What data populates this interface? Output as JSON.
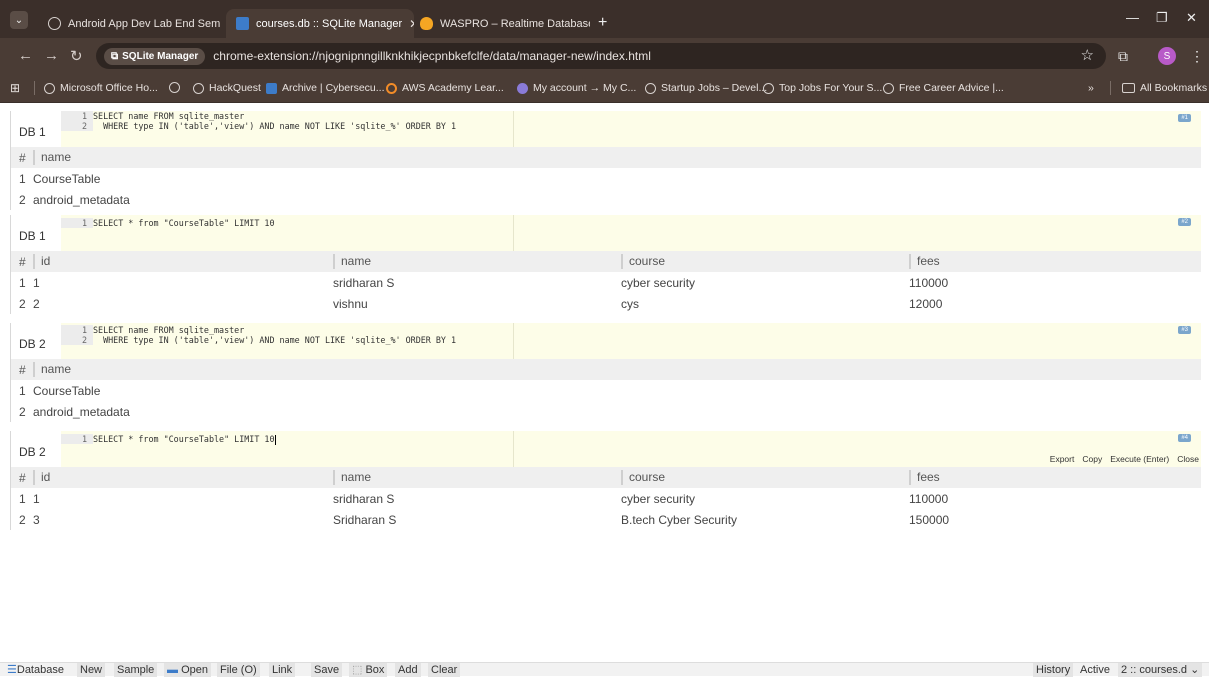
{
  "browser": {
    "tabs": [
      {
        "title": "Android App Dev Lab End Sem",
        "icon": "globe-icon",
        "active": false
      },
      {
        "title": "courses.db :: SQLite Manager",
        "icon": "grid-icon",
        "active": true
      },
      {
        "title": "WASPRO – Realtime Database",
        "icon": "firebase-icon",
        "active": false
      }
    ],
    "new_tab": "+",
    "site_chip": "SQLite Manager",
    "url": "chrome-extension://njognipnngillknkhikjecpnbkefclfe/data/manager-new/index.html",
    "profile_initial": "S",
    "bookmarks": [
      {
        "label": "Microsoft Office Ho...",
        "icon": "globe-icon"
      },
      {
        "label": "",
        "icon": "globe-icon"
      },
      {
        "label": "HackQuest",
        "icon": "globe-icon"
      },
      {
        "label": "Archive | Cybersecu...",
        "icon": "document-icon"
      },
      {
        "label": "AWS Academy Lear...",
        "icon": "aws-icon"
      },
      {
        "label": "My account → My C...",
        "icon": "account-icon"
      },
      {
        "label": "Startup Jobs – Devel...",
        "icon": "globe-icon"
      },
      {
        "label": "Top Jobs For Your S...",
        "icon": "globe-icon"
      },
      {
        "label": "Free Career Advice |...",
        "icon": "globe-icon"
      }
    ],
    "bookmarks_overflow": "»",
    "all_bookmarks": "All Bookmarks"
  },
  "panels": [
    {
      "db": "DB 1",
      "badge": "#1",
      "code": [
        {
          "n": "1",
          "text": "SELECT name FROM sqlite_master"
        },
        {
          "n": "2",
          "text": "  WHERE type IN ('table','view') AND name NOT LIKE 'sqlite_%' ORDER BY 1"
        }
      ],
      "columns": [
        "#",
        "name"
      ],
      "rows": [
        [
          "1",
          "CourseTable"
        ],
        [
          "2",
          "android_metadata"
        ]
      ]
    },
    {
      "db": "DB 1",
      "badge": "#2",
      "code": [
        {
          "n": "1",
          "text": "SELECT * from \"CourseTable\" LIMIT 10"
        }
      ],
      "columns": [
        "#",
        "id",
        "name",
        "course",
        "fees"
      ],
      "rows": [
        [
          "1",
          "1",
          "sridharan S",
          "cyber security",
          "110000"
        ],
        [
          "2",
          "2",
          "vishnu",
          "cys",
          "12000"
        ]
      ]
    },
    {
      "db": "DB 2",
      "badge": "#3",
      "code": [
        {
          "n": "1",
          "text": "SELECT name FROM sqlite_master"
        },
        {
          "n": "2",
          "text": "  WHERE type IN ('table','view') AND name NOT LIKE 'sqlite_%' ORDER BY 1"
        }
      ],
      "columns": [
        "#",
        "name"
      ],
      "rows": [
        [
          "1",
          "CourseTable"
        ],
        [
          "2",
          "android_metadata"
        ]
      ]
    },
    {
      "db": "DB 2",
      "badge": "#4",
      "code": [
        {
          "n": "1",
          "text": "SELECT * from \"CourseTable\" LIMIT 10"
        }
      ],
      "actions": [
        "Export",
        "Copy",
        "Execute (Enter)",
        "Close"
      ],
      "columns": [
        "#",
        "id",
        "name",
        "course",
        "fees"
      ],
      "rows": [
        [
          "1",
          "1",
          "sridharan S",
          "cyber security",
          "110000"
        ],
        [
          "2",
          "3",
          "Sridharan S",
          "B.tech Cyber Security",
          "150000"
        ]
      ]
    }
  ],
  "bottom": {
    "database": "Database",
    "new": "New",
    "sample": "Sample",
    "open": "Open",
    "file": "File (O)",
    "link": "Link",
    "save": "Save",
    "box": "Box",
    "add": "Add",
    "clear": "Clear",
    "history": "History",
    "active": "Active",
    "db_select": "2 :: courses.d"
  }
}
